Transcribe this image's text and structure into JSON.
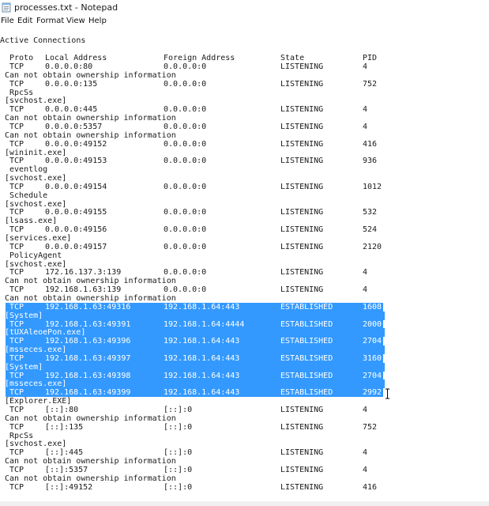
{
  "window": {
    "title": "processes.txt - Notepad",
    "icon": "notepad-icon"
  },
  "menu": [
    "File",
    "Edit",
    "Format",
    "View",
    "Help"
  ],
  "colors": {
    "selection": "#3399ff",
    "text": "#1a1a1a",
    "selected_text": "#ffffff"
  },
  "document": {
    "heading": "Active Connections",
    "columns": {
      "proto": "Proto",
      "local": "Local Address",
      "foreign": "Foreign Address",
      "state": "State",
      "pid": "PID"
    },
    "lines": [
      {
        "type": "conn",
        "proto": "TCP",
        "local": "0.0.0.0:80",
        "foreign": "0.0.0.0:0",
        "state": "LISTENING",
        "pid": "4"
      },
      {
        "type": "text",
        "text": "Can not obtain ownership information"
      },
      {
        "type": "conn",
        "proto": "TCP",
        "local": "0.0.0.0:135",
        "foreign": "0.0.0.0:0",
        "state": "LISTENING",
        "pid": "752"
      },
      {
        "type": "text",
        "text": " RpcSs"
      },
      {
        "type": "text",
        "text": "[svchost.exe]"
      },
      {
        "type": "conn",
        "proto": "TCP",
        "local": "0.0.0.0:445",
        "foreign": "0.0.0.0:0",
        "state": "LISTENING",
        "pid": "4"
      },
      {
        "type": "text",
        "text": "Can not obtain ownership information"
      },
      {
        "type": "conn",
        "proto": "TCP",
        "local": "0.0.0.0:5357",
        "foreign": "0.0.0.0:0",
        "state": "LISTENING",
        "pid": "4"
      },
      {
        "type": "text",
        "text": "Can not obtain ownership information"
      },
      {
        "type": "conn",
        "proto": "TCP",
        "local": "0.0.0.0:49152",
        "foreign": "0.0.0.0:0",
        "state": "LISTENING",
        "pid": "416"
      },
      {
        "type": "text",
        "text": "[wininit.exe]"
      },
      {
        "type": "conn",
        "proto": "TCP",
        "local": "0.0.0.0:49153",
        "foreign": "0.0.0.0:0",
        "state": "LISTENING",
        "pid": "936"
      },
      {
        "type": "text",
        "text": " eventlog"
      },
      {
        "type": "text",
        "text": "[svchost.exe]"
      },
      {
        "type": "conn",
        "proto": "TCP",
        "local": "0.0.0.0:49154",
        "foreign": "0.0.0.0:0",
        "state": "LISTENING",
        "pid": "1012"
      },
      {
        "type": "text",
        "text": " Schedule"
      },
      {
        "type": "text",
        "text": "[svchost.exe]"
      },
      {
        "type": "conn",
        "proto": "TCP",
        "local": "0.0.0.0:49155",
        "foreign": "0.0.0.0:0",
        "state": "LISTENING",
        "pid": "532"
      },
      {
        "type": "text",
        "text": "[lsass.exe]"
      },
      {
        "type": "conn",
        "proto": "TCP",
        "local": "0.0.0.0:49156",
        "foreign": "0.0.0.0:0",
        "state": "LISTENING",
        "pid": "524"
      },
      {
        "type": "text",
        "text": "[services.exe]"
      },
      {
        "type": "conn",
        "proto": "TCP",
        "local": "0.0.0.0:49157",
        "foreign": "0.0.0.0:0",
        "state": "LISTENING",
        "pid": "2120"
      },
      {
        "type": "text",
        "text": " PolicyAgent"
      },
      {
        "type": "text",
        "text": "[svchost.exe]"
      },
      {
        "type": "conn",
        "proto": "TCP",
        "local": "172.16.137.3:139",
        "foreign": "0.0.0.0:0",
        "state": "LISTENING",
        "pid": "4"
      },
      {
        "type": "text",
        "text": "Can not obtain ownership information"
      },
      {
        "type": "conn",
        "proto": "TCP",
        "local": "192.168.1.63:139",
        "foreign": "0.0.0.0:0",
        "state": "LISTENING",
        "pid": "4"
      },
      {
        "type": "text",
        "text": "Can not obtain ownership information"
      },
      {
        "type": "conn",
        "sel": true,
        "proto": "TCP",
        "local": "192.168.1.63:49316",
        "foreign": "192.168.1.64:443",
        "state": "ESTABLISHED",
        "pid": "1608"
      },
      {
        "type": "text",
        "sel": true,
        "text": "[System]"
      },
      {
        "type": "conn",
        "sel": true,
        "proto": "TCP",
        "local": "192.168.1.63:49391",
        "foreign": "192.168.1.64:4444",
        "state": "ESTABLISHED",
        "pid": "2000"
      },
      {
        "type": "text",
        "sel": true,
        "text": "[tUXAleoePon.exe]"
      },
      {
        "type": "conn",
        "sel": true,
        "proto": "TCP",
        "local": "192.168.1.63:49396",
        "foreign": "192.168.1.64:443",
        "state": "ESTABLISHED",
        "pid": "2704"
      },
      {
        "type": "text",
        "sel": true,
        "text": "[msseces.exe]"
      },
      {
        "type": "conn",
        "sel": true,
        "proto": "TCP",
        "local": "192.168.1.63:49397",
        "foreign": "192.168.1.64:443",
        "state": "ESTABLISHED",
        "pid": "3160"
      },
      {
        "type": "text",
        "sel": true,
        "text": "[System]"
      },
      {
        "type": "conn",
        "sel": true,
        "proto": "TCP",
        "local": "192.168.1.63:49398",
        "foreign": "192.168.1.64:443",
        "state": "ESTABLISHED",
        "pid": "2704"
      },
      {
        "type": "text",
        "sel": true,
        "text": "[msseces.exe]"
      },
      {
        "type": "conn",
        "sel": true,
        "proto": "TCP",
        "local": "192.168.1.63:49399",
        "foreign": "192.168.1.64:443",
        "state": "ESTABLISHED",
        "pid": "2992"
      },
      {
        "type": "text",
        "text": "[Explorer.EXE]"
      },
      {
        "type": "conn",
        "proto": "TCP",
        "local": "[::]:80",
        "foreign": "[::]:0",
        "state": "LISTENING",
        "pid": "4"
      },
      {
        "type": "text",
        "text": "Can not obtain ownership information"
      },
      {
        "type": "conn",
        "proto": "TCP",
        "local": "[::]:135",
        "foreign": "[::]:0",
        "state": "LISTENING",
        "pid": "752"
      },
      {
        "type": "text",
        "text": " RpcSs"
      },
      {
        "type": "text",
        "text": "[svchost.exe]"
      },
      {
        "type": "conn",
        "proto": "TCP",
        "local": "[::]:445",
        "foreign": "[::]:0",
        "state": "LISTENING",
        "pid": "4"
      },
      {
        "type": "text",
        "text": "Can not obtain ownership information"
      },
      {
        "type": "conn",
        "proto": "TCP",
        "local": "[::]:5357",
        "foreign": "[::]:0",
        "state": "LISTENING",
        "pid": "4"
      },
      {
        "type": "text",
        "text": "Can not obtain ownership information"
      },
      {
        "type": "conn",
        "proto": "TCP",
        "local": "[::]:49152",
        "foreign": "[::]:0",
        "state": "LISTENING",
        "pid": "416"
      }
    ]
  }
}
